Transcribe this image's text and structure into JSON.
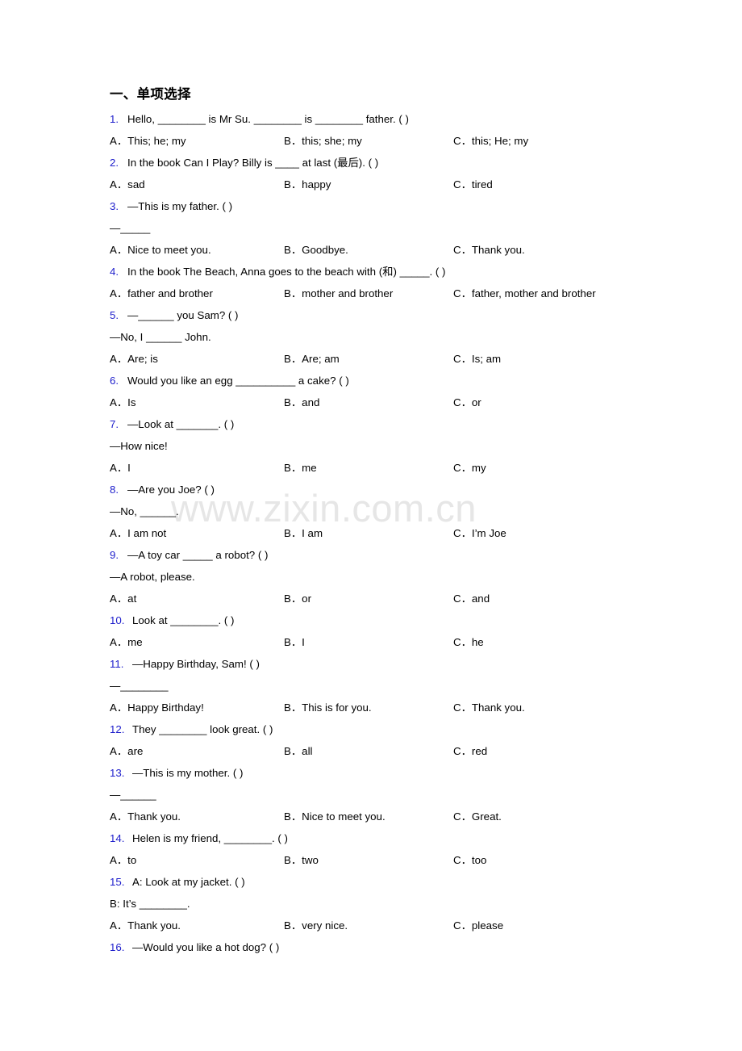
{
  "document": {
    "heading": "一、单项选择",
    "watermark": "www.zixin.com.cn",
    "accent_color": "#2020cc",
    "watermark_color": "#e6e6e6",
    "text_color": "#000000",
    "background_color": "#ffffff"
  },
  "questions": [
    {
      "number": "1.",
      "stem": "Hello, ________ is Mr Su. ________ is ________ father. (  )",
      "continuation": null,
      "options": [
        {
          "letter": "A．",
          "text": "This; he; my"
        },
        {
          "letter": "B．",
          "text": "this; she; my"
        },
        {
          "letter": "C．",
          "text": "this; He; my"
        }
      ]
    },
    {
      "number": "2.",
      "stem": "In the book Can I Play? Billy is ____ at last (最后). (  )",
      "continuation": null,
      "options": [
        {
          "letter": "A．",
          "text": "sad"
        },
        {
          "letter": "B．",
          "text": "happy"
        },
        {
          "letter": "C．",
          "text": "tired"
        }
      ]
    },
    {
      "number": "3.",
      "stem": "—This is my father. (  )",
      "continuation": "—_____",
      "options": [
        {
          "letter": "A．",
          "text": "Nice to meet you."
        },
        {
          "letter": "B．",
          "text": "Goodbye."
        },
        {
          "letter": "C．",
          "text": "Thank you."
        }
      ]
    },
    {
      "number": "4.",
      "stem": "In the book The Beach, Anna goes to the beach with (和) _____. (  )",
      "continuation": null,
      "options": [
        {
          "letter": "A．",
          "text": "father and brother"
        },
        {
          "letter": "B．",
          "text": "mother and brother"
        },
        {
          "letter": "C．",
          "text": "father, mother and brother"
        }
      ]
    },
    {
      "number": "5.",
      "stem": "—______ you Sam? (  )",
      "continuation": "—No, I ______ John.",
      "options": [
        {
          "letter": "A．",
          "text": "Are; is"
        },
        {
          "letter": "B．",
          "text": "Are; am"
        },
        {
          "letter": "C．",
          "text": "Is; am"
        }
      ]
    },
    {
      "number": "6.",
      "stem": "Would you like an egg __________ a cake? (  )",
      "continuation": null,
      "options": [
        {
          "letter": "A．",
          "text": "Is"
        },
        {
          "letter": "B．",
          "text": "and"
        },
        {
          "letter": "C．",
          "text": "or"
        }
      ]
    },
    {
      "number": "7.",
      "stem": "—Look at _______. (  )",
      "continuation": "—How nice!",
      "options": [
        {
          "letter": "A．",
          "text": "I"
        },
        {
          "letter": "B．",
          "text": "me"
        },
        {
          "letter": "C．",
          "text": "my"
        }
      ]
    },
    {
      "number": "8.",
      "stem": "—Are you Joe? (  )",
      "continuation": "—No, ______.",
      "options": [
        {
          "letter": "A．",
          "text": "I am not"
        },
        {
          "letter": "B．",
          "text": "I am"
        },
        {
          "letter": "C．",
          "text": "I’m Joe"
        }
      ]
    },
    {
      "number": "9.",
      "stem": "—A toy car _____ a robot? (  )",
      "continuation": "—A robot, please.",
      "options": [
        {
          "letter": "A．",
          "text": "at"
        },
        {
          "letter": "B．",
          "text": "or"
        },
        {
          "letter": "C．",
          "text": "and"
        }
      ]
    },
    {
      "number": "10.",
      "stem": "Look at ________. (     )",
      "continuation": null,
      "options": [
        {
          "letter": "A．",
          "text": "me"
        },
        {
          "letter": "B．",
          "text": "I"
        },
        {
          "letter": "C．",
          "text": "he"
        }
      ]
    },
    {
      "number": "11.",
      "stem": "—Happy Birthday, Sam! (  )",
      "continuation": "—________",
      "options": [
        {
          "letter": "A．",
          "text": "Happy Birthday!"
        },
        {
          "letter": "B．",
          "text": "This is for you."
        },
        {
          "letter": "C．",
          "text": "Thank you."
        }
      ]
    },
    {
      "number": "12.",
      "stem": "They ________ look great. (  )",
      "continuation": null,
      "options": [
        {
          "letter": "A．",
          "text": "are"
        },
        {
          "letter": "B．",
          "text": "all"
        },
        {
          "letter": "C．",
          "text": "red"
        }
      ]
    },
    {
      "number": "13.",
      "stem": "—This is my mother. (  )",
      "continuation": "—______",
      "options": [
        {
          "letter": "A．",
          "text": "Thank you."
        },
        {
          "letter": "B．",
          "text": "Nice to meet you."
        },
        {
          "letter": "C．",
          "text": "Great."
        }
      ]
    },
    {
      "number": "14.",
      "stem": "Helen is my friend, ________. (  )",
      "continuation": null,
      "options": [
        {
          "letter": "A．",
          "text": "to"
        },
        {
          "letter": "B．",
          "text": "two"
        },
        {
          "letter": "C．",
          "text": "too"
        }
      ]
    },
    {
      "number": "15.",
      "stem": "A: Look at my jacket. (    )",
      "continuation": "B: It’s ________.",
      "options": [
        {
          "letter": "A．",
          "text": "Thank you."
        },
        {
          "letter": "B．",
          "text": "very nice."
        },
        {
          "letter": "C．",
          "text": "please"
        }
      ]
    },
    {
      "number": "16.",
      "stem": "—Would you like a hot dog? (    )",
      "continuation": null,
      "options": []
    }
  ]
}
